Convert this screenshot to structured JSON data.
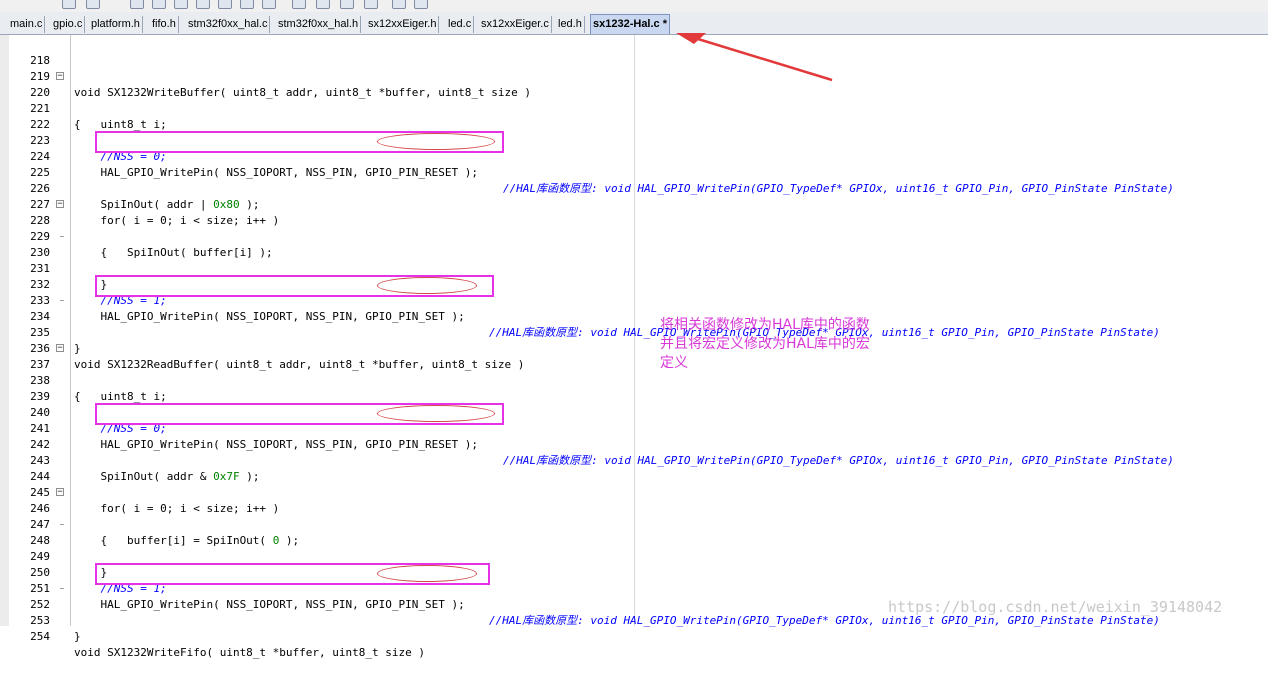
{
  "tabs": [
    {
      "label": "main.c"
    },
    {
      "label": "gpio.c"
    },
    {
      "label": "platform.h"
    },
    {
      "label": "fifo.h"
    },
    {
      "label": "stm32f0xx_hal.c"
    },
    {
      "label": "stm32f0xx_hal.h"
    },
    {
      "label": "sx12xxEiger.h"
    },
    {
      "label": "led.c"
    },
    {
      "label": "sx12xxEiger.c"
    },
    {
      "label": "led.h"
    },
    {
      "label": "sx1232-Hal.c *"
    }
  ],
  "lines": [
    {
      "n": "218",
      "text": ""
    },
    {
      "n": "219",
      "text": "void SX1232WriteBuffer( uint8_t addr, uint8_t *buffer, uint8_t size )"
    },
    {
      "n": "220",
      "text": "{"
    },
    {
      "n": "221",
      "text": "    uint8_t i;"
    },
    {
      "n": "222",
      "text": ""
    },
    {
      "n": "223",
      "text": "    //NSS = 0;"
    },
    {
      "n": "224",
      "text": "    HAL_GPIO_WritePin( NSS_IOPORT, NSS_PIN, GPIO_PIN_RESET );"
    },
    {
      "n": "225",
      "text": ""
    },
    {
      "n": "226",
      "text": "    SpiInOut( addr | 0x80 );"
    },
    {
      "n": "227",
      "text": "    for( i = 0; i < size; i++ )"
    },
    {
      "n": "228",
      "text": "    {"
    },
    {
      "n": "229",
      "text": "        SpiInOut( buffer[i] );"
    },
    {
      "n": "230",
      "text": "    }"
    },
    {
      "n": "231",
      "text": ""
    },
    {
      "n": "232",
      "text": "    //NSS = 1;"
    },
    {
      "n": "233",
      "text": "    HAL_GPIO_WritePin( NSS_IOPORT, NSS_PIN, GPIO_PIN_SET );"
    },
    {
      "n": "234",
      "text": "}"
    },
    {
      "n": "235",
      "text": ""
    },
    {
      "n": "236",
      "text": "void SX1232ReadBuffer( uint8_t addr, uint8_t *buffer, uint8_t size )"
    },
    {
      "n": "237",
      "text": "{"
    },
    {
      "n": "238",
      "text": "    uint8_t i;"
    },
    {
      "n": "239",
      "text": ""
    },
    {
      "n": "240",
      "text": "    //NSS = 0;"
    },
    {
      "n": "241",
      "text": "    HAL_GPIO_WritePin( NSS_IOPORT, NSS_PIN, GPIO_PIN_RESET );"
    },
    {
      "n": "242",
      "text": ""
    },
    {
      "n": "243",
      "text": "    SpiInOut( addr & 0x7F );"
    },
    {
      "n": "244",
      "text": ""
    },
    {
      "n": "245",
      "text": "    for( i = 0; i < size; i++ )"
    },
    {
      "n": "246",
      "text": "    {"
    },
    {
      "n": "247",
      "text": "        buffer[i] = SpiInOut( 0 );"
    },
    {
      "n": "248",
      "text": "    }"
    },
    {
      "n": "249",
      "text": ""
    },
    {
      "n": "250",
      "text": "    //NSS = 1;"
    },
    {
      "n": "251",
      "text": "    HAL_GPIO_WritePin( NSS_IOPORT, NSS_PIN, GPIO_PIN_SET );"
    },
    {
      "n": "252",
      "text": "}"
    },
    {
      "n": "253",
      "text": ""
    },
    {
      "n": "254",
      "text": "void SX1232WriteFifo( uint8_t *buffer, uint8_t size )"
    }
  ],
  "comments": {
    "line224": "//HAL库函数原型: void HAL_GPIO_WritePin(GPIO_TypeDef* GPIOx, uint16_t GPIO_Pin, GPIO_PinState PinState)",
    "line233": "//HAL库函数原型: void HAL_GPIO_WritePin(GPIO_TypeDef* GPIOx, uint16_t GPIO_Pin, GPIO_PinState PinState)",
    "line241": "//HAL库函数原型: void HAL_GPIO_WritePin(GPIO_TypeDef* GPIOx, uint16_t GPIO_Pin, GPIO_PinState PinState)",
    "line251": "//HAL库函数原型: void HAL_GPIO_WritePin(GPIO_TypeDef* GPIOx, uint16_t GPIO_Pin, GPIO_PinState PinState)"
  },
  "note": {
    "line1": "将相关函数修改为HAL库中的函数",
    "line2": "并且将宏定义修改为HAL库中的宏",
    "line3": "定义"
  },
  "watermark": "https://blog.csdn.net/weixin_39148042",
  "colors": {
    "highlight": "#e632e6",
    "oval": "#d24a4a",
    "arrow": "#e23a3a",
    "comment": "#0000ff",
    "number": "#008000",
    "note": "#d838d8"
  }
}
